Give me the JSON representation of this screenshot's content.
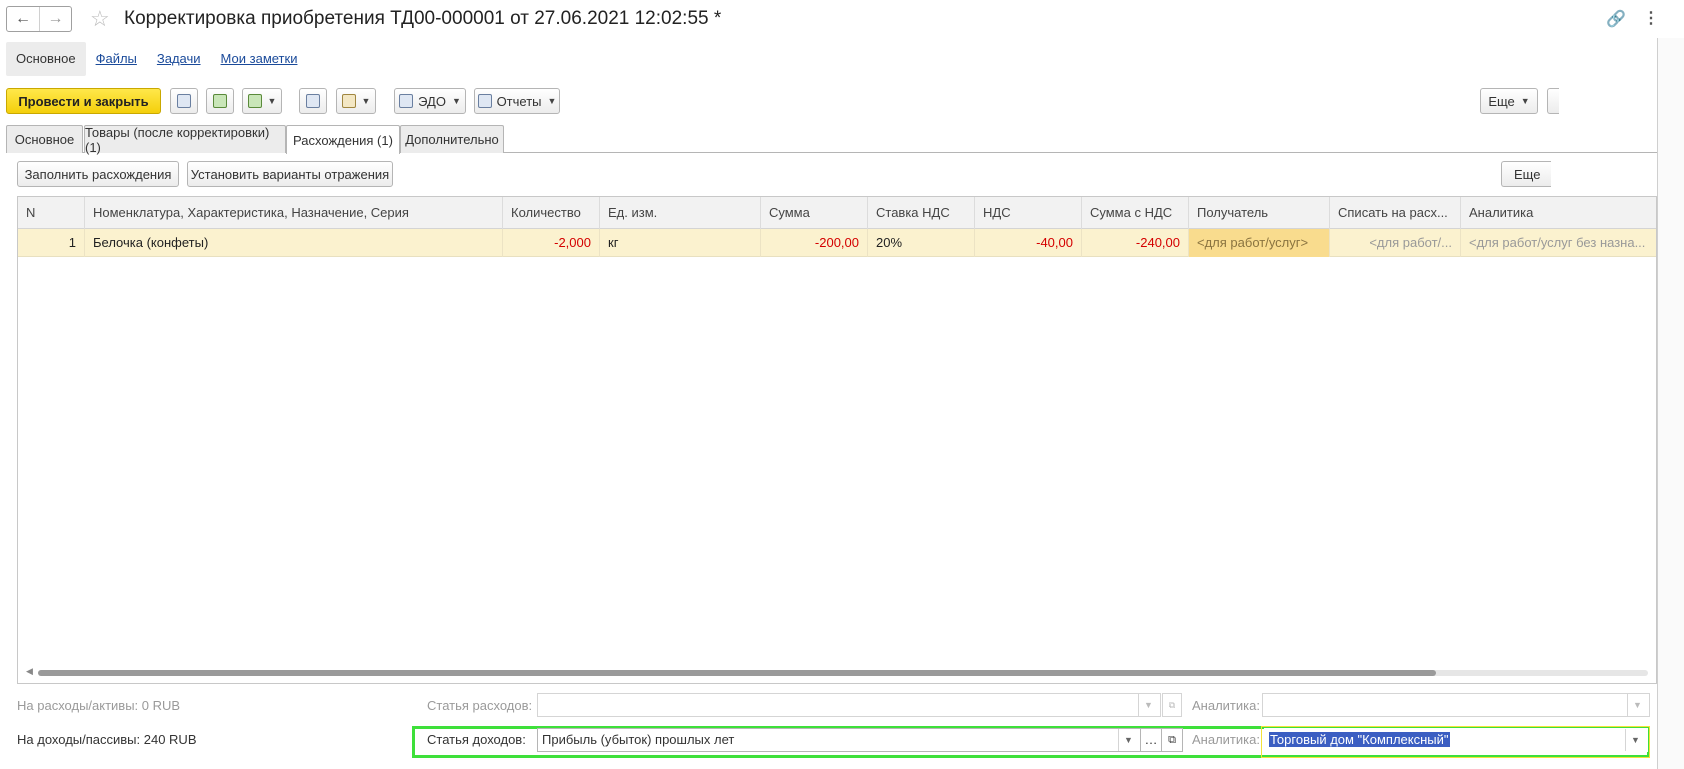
{
  "window": {
    "title": "Корректировка приобретения ТД00-000001 от 27.06.2021 12:02:55 *"
  },
  "subnav": {
    "items": [
      {
        "label": "Основное"
      },
      {
        "label": "Файлы"
      },
      {
        "label": "Задачи"
      },
      {
        "label": "Мои заметки"
      }
    ]
  },
  "toolbar": {
    "post_close_label": "Провести и закрыть",
    "edo_label": "ЭДО",
    "reports_label": "Отчеты",
    "more_label": "Еще"
  },
  "tabs": [
    {
      "label": "Основное"
    },
    {
      "label": "Товары (после корректировки) (1)"
    },
    {
      "label": "Расхождения (1)"
    },
    {
      "label": "Дополнительно"
    }
  ],
  "actions": {
    "fill_label": "Заполнить расхождения",
    "set_variants_label": "Установить варианты отражения",
    "more_label": "Еще"
  },
  "table": {
    "columns": [
      "N",
      "Номенклатура, Характеристика, Назначение, Серия",
      "Количество",
      "Ед. изм.",
      "Сумма",
      "Ставка НДС",
      "НДС",
      "Сумма с НДС",
      "Получатель",
      "Списать на расх...",
      "Аналитика"
    ],
    "rows": [
      {
        "n": "1",
        "item": "Белочка (конфеты)",
        "qty": "-2,000",
        "unit": "кг",
        "sum": "-200,00",
        "vat_rate": "20%",
        "vat": "-40,00",
        "sum_vat": "-240,00",
        "recipient": "<для работ/услуг>",
        "write_off": "<для работ/...",
        "analytics": "<для работ/услуг без назна..."
      }
    ]
  },
  "footer": {
    "expenses_total": "На расходы/активы: 0 RUB",
    "income_total": "На доходы/пассивы: 240 RUB",
    "expense_item_label": "Статья расходов:",
    "expense_item_value": "",
    "expense_analytics_label": "Аналитика:",
    "expense_analytics_value": "",
    "income_item_label": "Статья доходов:",
    "income_item_value": "Прибыль (убыток) прошлых лет",
    "income_analytics_label": "Аналитика:",
    "income_analytics_value": "Торговый дом \"Комплексный\""
  },
  "colors": {
    "primary_button": "#f4cf0b",
    "negative_value": "#d40000",
    "highlight_row": "#fbf2cf",
    "focus_frame": "#3ee03a"
  }
}
